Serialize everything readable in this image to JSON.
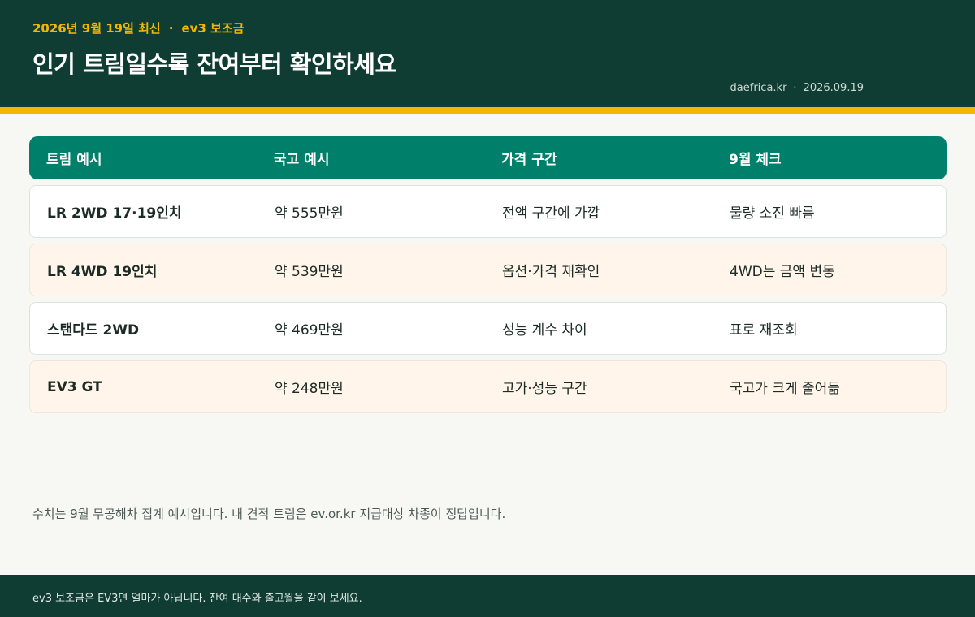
{
  "header": {
    "eyebrow_date": "2026년 9월 19일 최신",
    "eyebrow_sep": "·",
    "eyebrow_topic": "ev3 보조금",
    "title": "인기 트림일수록 잔여부터 확인하세요",
    "meta_site": "daefrica.kr",
    "meta_sep": "·",
    "meta_date": "2026.09.19"
  },
  "table": {
    "columns": [
      "트림 예시",
      "국고 예시",
      "가격 구간",
      "9월 체크"
    ],
    "rows": [
      [
        "LR 2WD 17·19인치",
        "약 555만원",
        "전액 구간에 가깝",
        "물량 소진 빠름"
      ],
      [
        "LR 4WD 19인치",
        "약 539만원",
        "옵션·가격 재확인",
        "4WD는 금액 변동"
      ],
      [
        "스탠다드 2WD",
        "약 469만원",
        "성능 계수 차이",
        "표로 재조회"
      ],
      [
        "EV3 GT",
        "약 248만원",
        "고가·성능 구간",
        "국고가 크게 줄어듦"
      ]
    ]
  },
  "note": "수치는 9월 무공해차 집계 예시입니다. 내 견적 트림은 ev.or.kr 지급대상 차종이 정답입니다.",
  "footer": "ev3 보조금은 EV3면 얼마가 아닙니다. 잔여 대수와 출고월을 같이 보세요.",
  "colors": {
    "header_bg": "#0f3d33",
    "accent_yellow": "#f2b705",
    "table_head_bg": "#00806a",
    "alt_row_bg": "#fff5ea"
  }
}
